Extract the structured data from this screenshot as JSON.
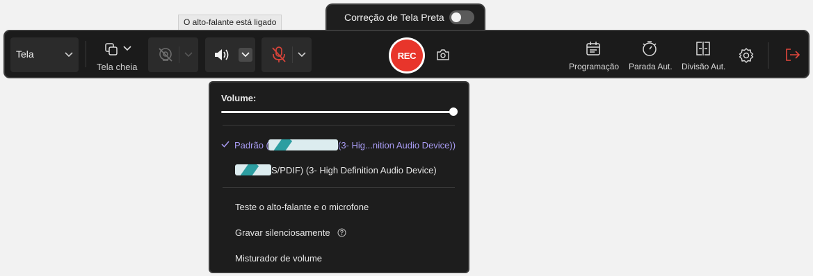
{
  "black_correction": {
    "label": "Correção de Tela Preta",
    "enabled": false
  },
  "tooltip": {
    "text": "O alto-falante está ligado"
  },
  "toolbar": {
    "screen_select": {
      "value": "Tela"
    },
    "fullscreen": {
      "label": "Tela cheia"
    },
    "webcam": {
      "enabled": false
    },
    "speaker": {
      "enabled": true
    },
    "microphone": {
      "enabled": false
    },
    "rec_label": "REC",
    "schedule_label": "Programação",
    "auto_stop_label": "Parada Aut.",
    "auto_split_label": "Divisão Aut."
  },
  "speaker_menu": {
    "volume_label": "Volume:",
    "volume_level": 1.0,
    "devices": [
      {
        "label": "Padrão (",
        "label_tail": " (3- Hig...nition Audio Device))",
        "selected": true
      },
      {
        "label": "",
        "label_tail": "S/PDIF) (3- High Definition Audio Device)",
        "selected": false
      }
    ],
    "actions": [
      "Teste o alto-falante e o microfone",
      "Gravar silenciosamente",
      "Misturador de volume"
    ]
  },
  "colors": {
    "rec": "#e8352b",
    "selected_device": "#a99cf4",
    "toolbar_bg": "#1b1b1b"
  }
}
